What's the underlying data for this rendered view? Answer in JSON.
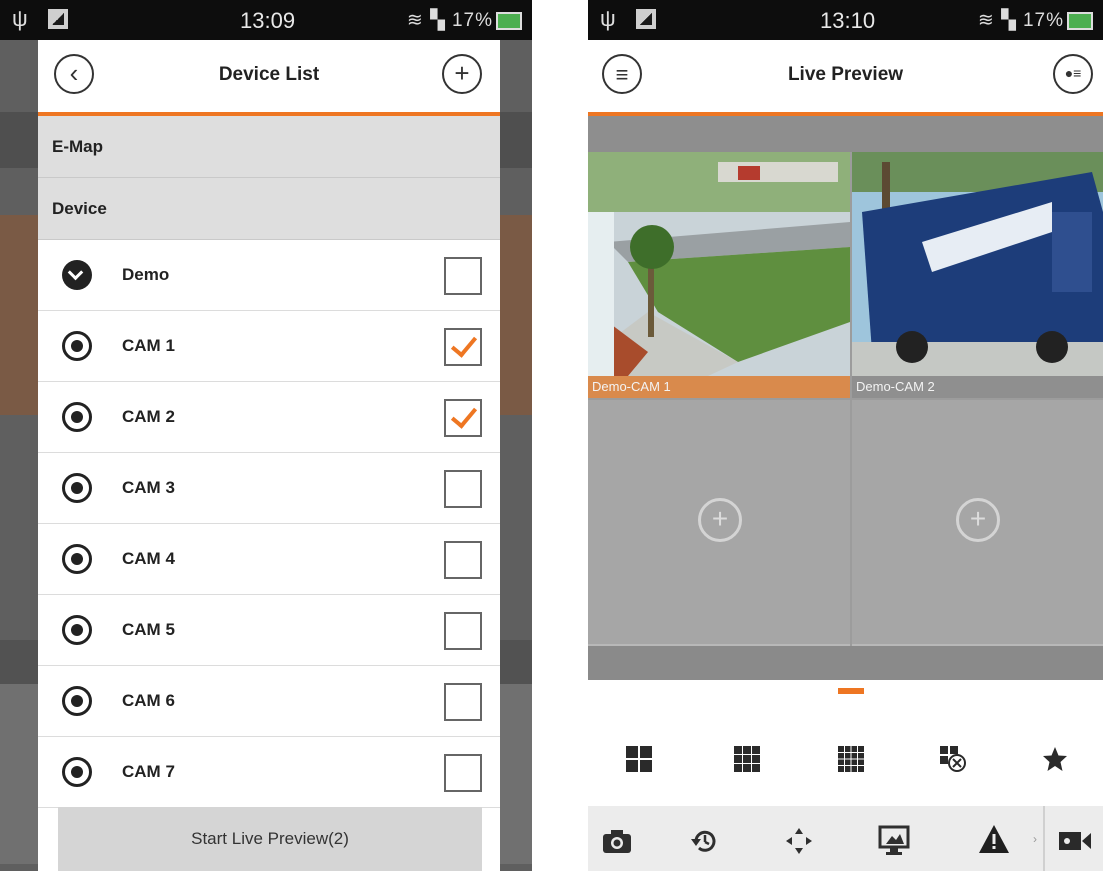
{
  "left": {
    "status": {
      "time": "13:09",
      "right_text": "17%"
    },
    "dialog": {
      "title": "Device List",
      "sections": [
        "E-Map",
        "Device"
      ],
      "rows": [
        {
          "label": "Demo",
          "checked": false,
          "kind": "device"
        },
        {
          "label": "CAM 1",
          "checked": true,
          "kind": "camera"
        },
        {
          "label": "CAM 2",
          "checked": true,
          "kind": "camera"
        },
        {
          "label": "CAM 3",
          "checked": false,
          "kind": "camera"
        },
        {
          "label": "CAM 4",
          "checked": false,
          "kind": "camera"
        },
        {
          "label": "CAM 5",
          "checked": false,
          "kind": "camera"
        },
        {
          "label": "CAM 6",
          "checked": false,
          "kind": "camera"
        },
        {
          "label": "CAM 7",
          "checked": false,
          "kind": "camera"
        }
      ],
      "start_button": "Start Live Preview(2)"
    }
  },
  "right": {
    "status": {
      "time": "13:10",
      "right_text": "17%"
    },
    "title": "Live Preview",
    "tiles": [
      {
        "label": "Demo-CAM 1",
        "selected": true
      },
      {
        "label": "Demo-CAM 2",
        "selected": false
      }
    ],
    "layout_icons": [
      "grid-2x2-icon",
      "grid-3x3-icon",
      "grid-4x4-icon",
      "close-layout-icon",
      "star-icon"
    ],
    "toolbar_icons": [
      "camera-icon",
      "playback-icon",
      "ptz-arrows-icon",
      "display-icon",
      "warning-icon",
      "record-icon"
    ],
    "colors": {
      "accent": "#ee7622",
      "selected_tile_label": "#d98a4c"
    }
  }
}
